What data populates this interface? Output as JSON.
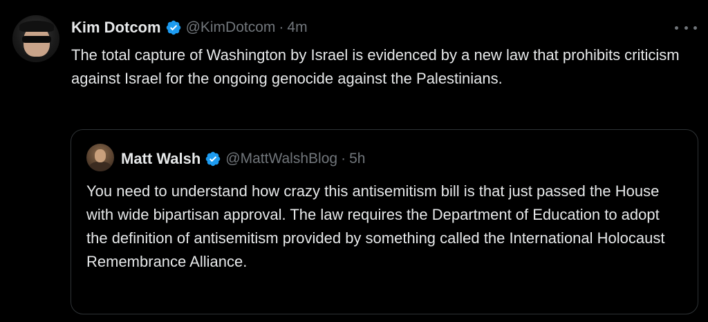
{
  "tweet": {
    "author_name": "Kim Dotcom",
    "handle": "@KimDotcom",
    "separator": "·",
    "time": "4m",
    "text": "The total capture of Washington by Israel is evidenced by a new law that prohibits criticism against Israel for the ongoing genocide against the Palestinians.",
    "verified_icon": "verified-badge-icon",
    "more_icon": "more-options-icon"
  },
  "quoted_tweet": {
    "author_name": "Matt Walsh",
    "handle": "@MattWalshBlog",
    "separator": "·",
    "time": "5h",
    "text": "You need to understand how crazy this antisemitism bill is that just passed the House with wide bipartisan approval. The law requires the Department of Education to adopt the definition of antisemitism provided by something called the International Holocaust Remembrance Alliance.",
    "verified_icon": "verified-badge-icon"
  },
  "colors": {
    "background": "#000000",
    "text": "#e7e9ea",
    "secondary_text": "#71767b",
    "verified": "#1d9bf0",
    "border": "#2f3336"
  }
}
